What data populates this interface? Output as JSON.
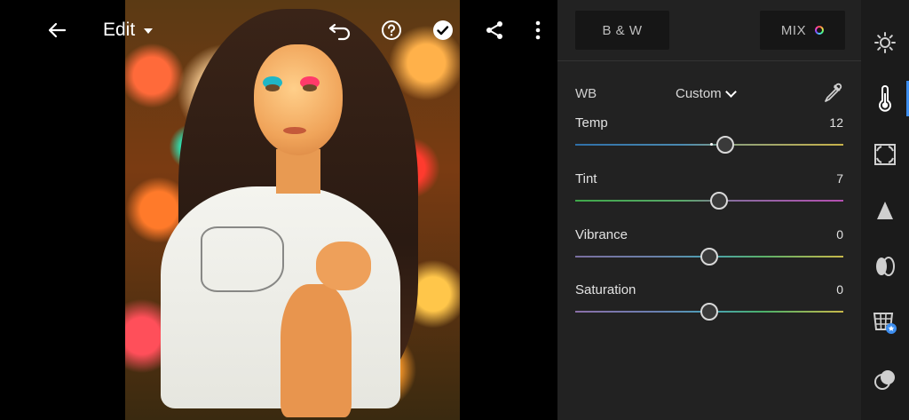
{
  "top_bar": {
    "edit_label": "Edit"
  },
  "profiles": {
    "bw_label": "B & W",
    "mix_label": "MIX"
  },
  "white_balance": {
    "label": "WB",
    "preset": "Custom"
  },
  "sliders": [
    {
      "label": "Temp",
      "value": "12",
      "position": 0.56
    },
    {
      "label": "Tint",
      "value": "7",
      "position": 0.535
    },
    {
      "label": "Vibrance",
      "value": "0",
      "position": 0.5
    },
    {
      "label": "Saturation",
      "value": "0",
      "position": 0.5
    }
  ],
  "rail_tools": [
    "light-icon",
    "color-icon",
    "effects-icon",
    "detail-icon",
    "optics-icon",
    "geometry-icon",
    "presets-icon"
  ],
  "colors": {
    "panel_bg": "#222222",
    "accent": "#3d8ef0",
    "button_bg": "#161616"
  }
}
